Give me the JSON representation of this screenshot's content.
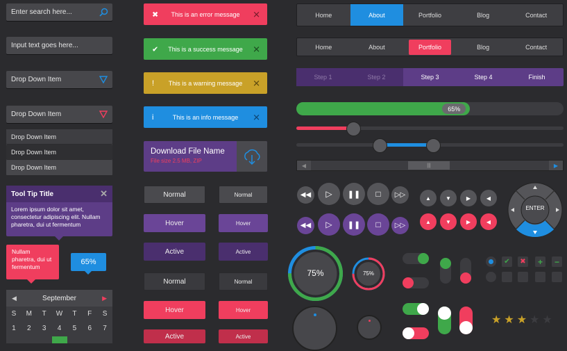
{
  "colors": {
    "red": "#f03e5e",
    "green": "#3fa84a",
    "yellow": "#c9a128",
    "blue": "#1f8ee0",
    "purple": "#5d3d87",
    "dark": "#3c3c40"
  },
  "left": {
    "search_placeholder": "Enter search here...",
    "input_text": "Input text goes here...",
    "dropdown1": "Drop Down Item",
    "dropdown2": "Drop Down Item",
    "dropdown_items": [
      "Drop Down Item",
      "Drop Down Item",
      "Drop Down Item"
    ],
    "tooltip": {
      "title": "Tool Tip Title",
      "body": "Lorem ipsum dolor sit amet, consectetur adipiscing elit. Nullam pharetra, dui ut fermentum"
    },
    "tooltip_pink": "Nullam pharetra, dui ut fermentum",
    "badge_value": "65%",
    "calendar": {
      "month": "September",
      "days": [
        "S",
        "M",
        "T",
        "W",
        "T",
        "F",
        "S"
      ],
      "dates": [
        "1",
        "2",
        "3",
        "4",
        "5",
        "6",
        "7"
      ],
      "selected": "4"
    }
  },
  "alerts": {
    "error": "This is an error message",
    "success": "This is a success message",
    "warning": "This is a warning message",
    "info": "This is an info message"
  },
  "download": {
    "title": "Download File Name",
    "meta": "File size 2.5 MB, ZIP"
  },
  "buttons": {
    "wide": [
      "Normal",
      "Hover",
      "Active",
      "Normal",
      "Hover",
      "Active"
    ],
    "small": [
      "Normal",
      "Hover",
      "Active",
      "Normal",
      "Hover",
      "Active"
    ]
  },
  "nav1": {
    "items": [
      "Home",
      "About",
      "Portfolio",
      "Blog",
      "Contact"
    ],
    "active": "About"
  },
  "nav2": {
    "items": [
      "Home",
      "About",
      "Portfolio",
      "Blog",
      "Contact"
    ],
    "active": "Portfolio"
  },
  "steps": {
    "items": [
      "Step 1",
      "Step 2",
      "Step 3",
      "Step 4",
      "Finish"
    ]
  },
  "progress": {
    "value": 0.65,
    "label": "65%"
  },
  "slider": {
    "value": 0.21,
    "range": [
      0.31,
      0.51
    ]
  },
  "knobs": {
    "big_label": "75%",
    "small_label": "75%",
    "big_value": 0.75,
    "small_value": 0.75
  },
  "dpad": {
    "center": "ENTER"
  },
  "rating": {
    "value": 3,
    "max": 5
  },
  "icon_names": [
    "rewind-icon",
    "play-icon",
    "pause-icon",
    "stop-icon",
    "fast-forward-icon"
  ]
}
